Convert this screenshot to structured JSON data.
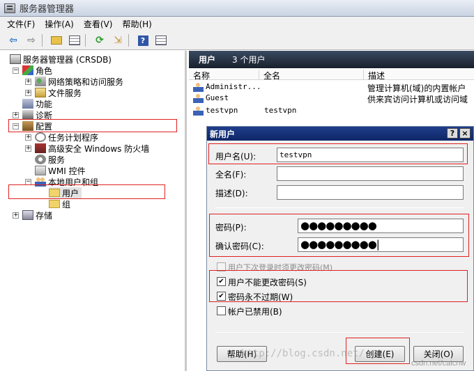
{
  "window": {
    "title": "服务器管理器"
  },
  "menu": [
    "文件(F)",
    "操作(A)",
    "查看(V)",
    "帮助(H)"
  ],
  "toolbar": {
    "icons": [
      "back-arrow-icon",
      "forward-arrow-icon",
      "folder-up-icon",
      "show-tree-icon",
      "refresh-icon",
      "export-icon",
      "help-icon",
      "properties-icon"
    ]
  },
  "tree": {
    "root": "服务器管理器 (CRSDB)",
    "roles": "角色",
    "network_policy": "网络策略和访问服务",
    "file_services": "文件服务",
    "features": "功能",
    "diagnostics": "诊断",
    "configuration": "配置",
    "task_scheduler": "任务计划程序",
    "firewall": "高级安全 Windows 防火墙",
    "services": "服务",
    "wmi": "WMI 控件",
    "local_users_groups": "本地用户和组",
    "users": "用户",
    "groups": "组",
    "storage": "存储"
  },
  "right_pane": {
    "header_title": "用户",
    "header_count": "3 个用户",
    "columns": [
      "名称",
      "全名",
      "描述"
    ],
    "rows": [
      {
        "name": "Administr...",
        "fullname": "",
        "description": "管理计算机(域)的内置帐户"
      },
      {
        "name": "Guest",
        "fullname": "",
        "description": "供来宾访问计算机或访问域"
      },
      {
        "name": "testvpn",
        "fullname": "testvpn",
        "description": ""
      }
    ]
  },
  "dialog": {
    "title": "新用户",
    "help_btn": "?",
    "close_btn": "×",
    "username_label": "用户名(U):",
    "username_value": "testvpn",
    "fullname_label": "全名(F):",
    "fullname_value": "",
    "description_label": "描述(D):",
    "description_value": "",
    "password_label": "密码(P):",
    "password_value": "●●●●●●●●●",
    "confirm_label": "确认密码(C):",
    "confirm_value": "●●●●●●●●●|",
    "options": [
      {
        "label": "用户下次登录时须更改密码(M)",
        "checked": false,
        "disabled": true
      },
      {
        "label": "用户不能更改密码(S)",
        "checked": true,
        "disabled": false
      },
      {
        "label": "密码永不过期(W)",
        "checked": true,
        "disabled": false
      },
      {
        "label": "帐户已禁用(B)",
        "checked": false,
        "disabled": false
      }
    ],
    "help_button": "帮助(H)",
    "create_button": "创建(E)",
    "close_button": "关闭(O)"
  },
  "watermark": "http://blog.csdn.net/",
  "watermark_corner": "csdn.net/caicnw",
  "colors": {
    "highlight_box": "#e02020",
    "dialog_title": "#1f3e8a",
    "pane_header": "#18202c"
  }
}
